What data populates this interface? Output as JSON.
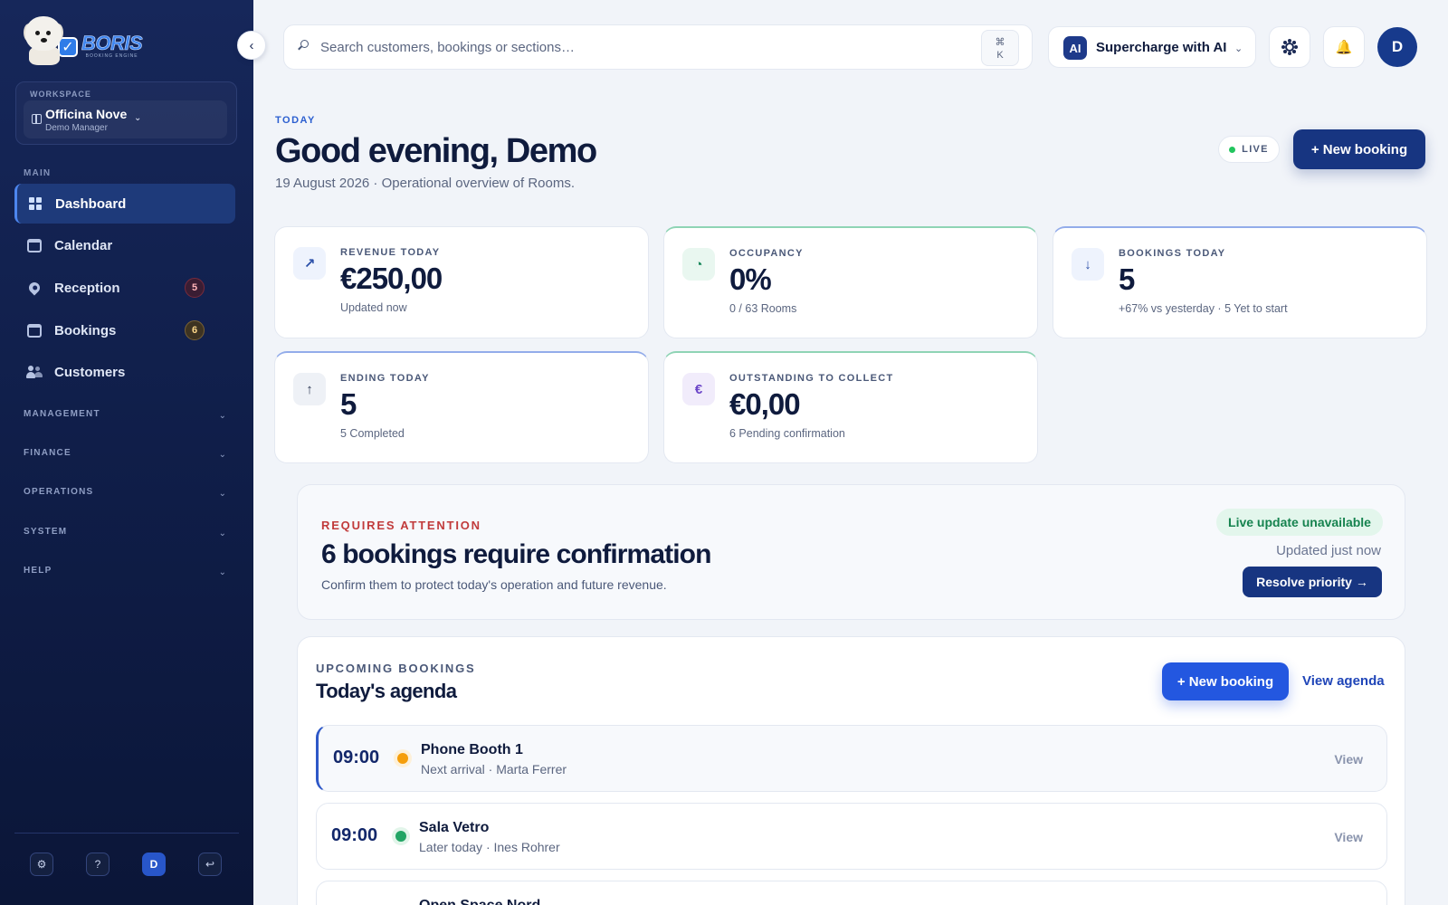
{
  "brand": {
    "name": "BORIS",
    "tagline": "BOOKING ENGINE"
  },
  "workspace": {
    "caption": "WORKSPACE",
    "name": "Officina Nove",
    "role": "Demo Manager"
  },
  "sidebar": {
    "main_label": "MAIN",
    "items": [
      {
        "label": "Dashboard",
        "icon": "grid-icon",
        "active": true
      },
      {
        "label": "Calendar",
        "icon": "calendar-icon"
      },
      {
        "label": "Reception",
        "icon": "location-pin-icon",
        "badge": "5"
      },
      {
        "label": "Bookings",
        "icon": "calendar-check-icon",
        "badge": "6"
      },
      {
        "label": "Customers",
        "icon": "users-icon"
      }
    ],
    "groups": [
      "MANAGEMENT",
      "FINANCE",
      "OPERATIONS",
      "SYSTEM",
      "HELP"
    ],
    "footer": {
      "settings": "⚙",
      "help": "?",
      "avatar": "D",
      "logout": "↩"
    }
  },
  "topbar": {
    "search_placeholder": "Search customers, bookings or sections…",
    "shortcut_symbol": "⌘",
    "shortcut_key": "K",
    "ai_badge": "AI",
    "ai_label": "Supercharge with AI",
    "avatar": "D"
  },
  "header": {
    "eyebrow": "TODAY",
    "title": "Good evening, Demo",
    "subtitle": "19 August 2026 · Operational overview of Rooms.",
    "live": "LIVE",
    "new_booking": "+ New booking"
  },
  "kpis": [
    {
      "label": "REVENUE TODAY",
      "value": "€250,00",
      "sub": "Updated now",
      "icon": "↗"
    },
    {
      "label": "OCCUPANCY",
      "value": "0%",
      "sub": "0 / 63 Rooms",
      "icon": "◔"
    },
    {
      "label": "BOOKINGS TODAY",
      "value": "5",
      "sub": "+67% vs yesterday · 5 Yet to start",
      "icon": "↓"
    },
    {
      "label": "ENDING TODAY",
      "value": "5",
      "sub": "5 Completed",
      "icon": "↑"
    },
    {
      "label": "OUTSTANDING TO COLLECT",
      "value": "€0,00",
      "sub": "6 Pending confirmation",
      "icon": "€"
    }
  ],
  "attention": {
    "eyebrow": "REQUIRES ATTENTION",
    "title": "6 bookings require confirmation",
    "subtitle": "Confirm them to protect today's operation and future revenue.",
    "status": "Live update unavailable",
    "updated": "Updated just now",
    "action": "Resolve priority →"
  },
  "agenda": {
    "eyebrow": "UPCOMING BOOKINGS",
    "title": "Today's agenda",
    "new_booking": "+ New booking",
    "view_agenda": "View agenda",
    "rows": [
      {
        "time": "09:00",
        "name": "Phone Booth 1",
        "sub": "Next arrival · Marta Ferrer",
        "status": "orange",
        "action": "View"
      },
      {
        "time": "09:00",
        "name": "Sala Vetro",
        "sub": "Later today · Ines Rohrer",
        "status": "green",
        "action": "View"
      },
      {
        "time": "",
        "name": "Open Space Nord",
        "sub": "",
        "status": "",
        "action": ""
      }
    ]
  }
}
